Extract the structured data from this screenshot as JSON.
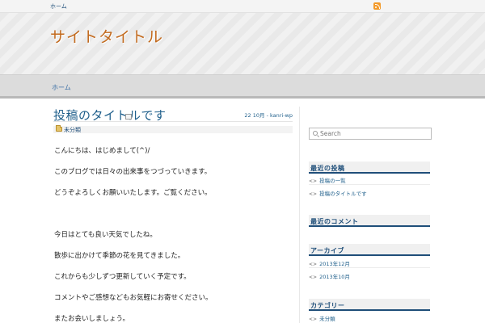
{
  "topbar": {
    "home_link": "ホーム"
  },
  "header": {
    "site_title": "サイトタイトル"
  },
  "nav": {
    "items": [
      "ホーム"
    ]
  },
  "post": {
    "title": "投稿のタイトルです",
    "meta": "22 10月 - kanri-wp",
    "category": "未分類",
    "paragraphs": [
      "こんにちは、はじめまして(^)/",
      "このブログでは日々の出来事をつづっていきます。",
      "どうぞよろしくお願いいたします。ご覧ください。",
      "今日はとても良い天気でしたね。",
      "散歩に出かけて季節の花を見てきました。",
      "これからも少しずつ更新していく予定です。",
      "コメントやご感想などもお気軽にお寄せください。",
      "またお会いしましょう。"
    ]
  },
  "sidebar": {
    "search_placeholder": "Search",
    "widgets": [
      {
        "title": "最近の投稿",
        "items": [
          "投稿の一覧",
          "投稿のタイトルです"
        ]
      },
      {
        "title": "最近のコメント",
        "items": []
      },
      {
        "title": "アーカイブ",
        "items": [
          "2013年12月",
          "2013年10月"
        ]
      },
      {
        "title": "カテゴリー",
        "items": [
          "未分類"
        ]
      }
    ]
  },
  "colors": {
    "accent": "#1f4e79",
    "title_orange": "#c26a1e",
    "rss": "#f39a2a"
  }
}
